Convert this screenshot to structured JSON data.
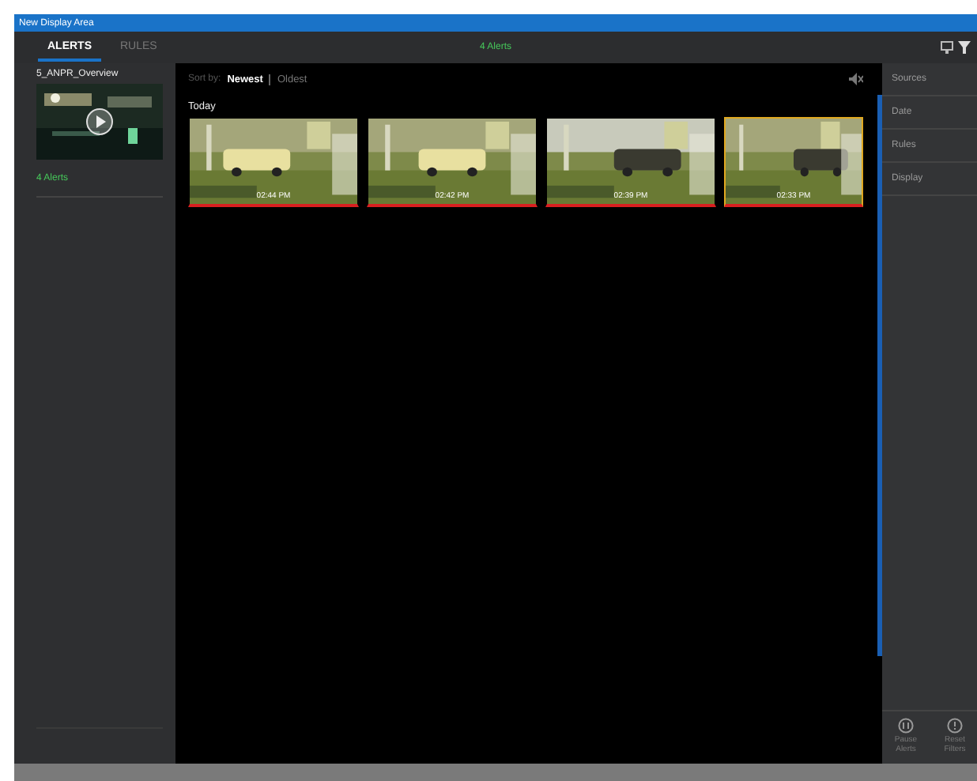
{
  "window": {
    "title": "New Display Area"
  },
  "tabs": [
    {
      "label": "ALERTS",
      "selected": true
    },
    {
      "label": "RULES",
      "selected": false
    }
  ],
  "header": {
    "alert_count": "4 Alerts"
  },
  "sidebar": {
    "items": [
      {
        "name": "5_ANPR_Overview",
        "alerts": "4 Alerts",
        "kind": "picture"
      }
    ]
  },
  "sort": {
    "label": "Sort by:",
    "options": [
      {
        "label": "Newest",
        "selected": true
      },
      {
        "label": "Oldest",
        "selected": false
      }
    ]
  },
  "groups": [
    {
      "title": "Today",
      "alerts": [
        {
          "time": "02:44 PM",
          "selected": false,
          "kind": "picture"
        },
        {
          "time": "02:42 PM",
          "selected": false,
          "kind": "picture"
        },
        {
          "time": "02:39 PM",
          "selected": false,
          "kind": "picture"
        },
        {
          "time": "02:33 PM",
          "selected": true,
          "kind": "picture"
        }
      ]
    }
  ],
  "filters": [
    {
      "label": "Sources"
    },
    {
      "label": "Date"
    },
    {
      "label": "Rules"
    },
    {
      "label": "Display"
    }
  ],
  "actions": [
    {
      "label": "Pause Alerts",
      "kind": "pause"
    },
    {
      "label": "Reset Filters",
      "kind": "reset"
    }
  ]
}
